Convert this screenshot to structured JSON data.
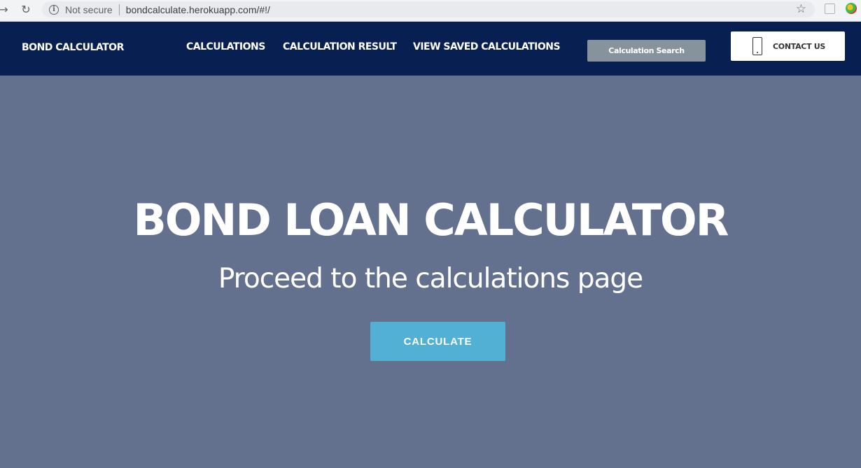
{
  "browser": {
    "security_label": "Not secure",
    "url": "bondcalculate.herokuapp.com/#!/"
  },
  "navbar": {
    "brand": "BOND CALCULATOR",
    "links": [
      {
        "label": "CALCULATIONS"
      },
      {
        "label": "CALCULATION RESULT"
      },
      {
        "label": "VIEW SAVED CALCULATIONS"
      }
    ],
    "search_button": "Calculation Search",
    "contact_button": "CONTACT US"
  },
  "hero": {
    "title": "BOND LOAN CALCULATOR",
    "subtitle": "Proceed to the calculations page",
    "cta": "CALCULATE"
  },
  "colors": {
    "navbar_bg": "#071f51",
    "hero_bg": "#64718e",
    "search_button_bg": "#87939c",
    "cta_bg": "#52b0d4"
  },
  "icons": [
    "back-arrow-icon",
    "reload-icon",
    "info-icon",
    "star-icon",
    "extension-icon",
    "phone-icon"
  ]
}
